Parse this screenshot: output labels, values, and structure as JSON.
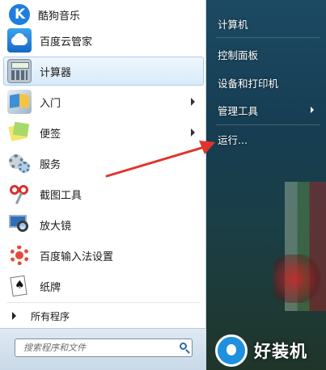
{
  "left_menu": {
    "items": [
      {
        "label": "酷狗音乐",
        "icon": "kugou-music-icon",
        "submenu": false
      },
      {
        "label": "百度云管家",
        "icon": "baidu-cloud-icon",
        "submenu": false
      },
      {
        "label": "计算器",
        "icon": "calculator-icon",
        "submenu": false,
        "selected": true
      },
      {
        "label": "入门",
        "icon": "getting-started-icon",
        "submenu": true
      },
      {
        "label": "便签",
        "icon": "sticky-notes-icon",
        "submenu": true
      },
      {
        "label": "服务",
        "icon": "services-gear-icon",
        "submenu": false
      },
      {
        "label": "截图工具",
        "icon": "snipping-tool-icon",
        "submenu": false
      },
      {
        "label": "放大镜",
        "icon": "magnifier-icon",
        "submenu": false
      },
      {
        "label": "百度输入法设置",
        "icon": "baidu-ime-settings-icon",
        "submenu": false
      },
      {
        "label": "纸牌",
        "icon": "solitaire-icon",
        "submenu": false
      }
    ],
    "all_programs": "所有程序",
    "search_placeholder": "搜索程序和文件"
  },
  "right_menu": {
    "items": [
      {
        "label": "计算机",
        "submenu": false
      },
      {
        "label": "控制面板",
        "submenu": false
      },
      {
        "label": "设备和打印机",
        "submenu": false
      },
      {
        "label": "管理工具",
        "submenu": true
      },
      {
        "label": "运行...",
        "submenu": false
      }
    ]
  },
  "watermark": {
    "text": "好装机"
  },
  "colors": {
    "accent_arrow": "#e0342c",
    "selection": "#d9ebfa",
    "right_pane": "#1c4a63"
  }
}
